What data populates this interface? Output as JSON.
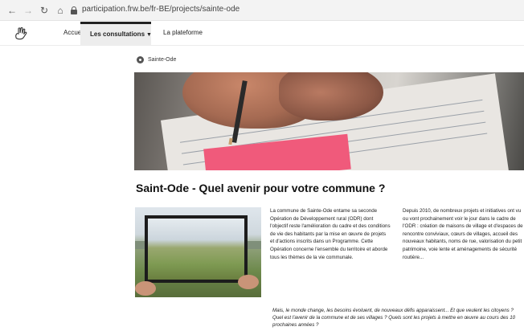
{
  "browser": {
    "back_icon": "arrow-left-icon",
    "forward_icon": "arrow-right-icon",
    "reload_icon": "reload-icon",
    "home_icon": "home-icon",
    "url": "participation.frw.be/fr-BE/projects/sainte-ode"
  },
  "header": {
    "logo_icon": "hand-logo-icon",
    "nav": {
      "accueil": "Accueil",
      "consultations": "Les consultations",
      "plateforme": "La plateforme"
    }
  },
  "breadcrumb": {
    "label": "Sainte-Ode"
  },
  "main": {
    "title": "Saint-Ode - Quel avenir pour votre commune ?",
    "paragraph_left": "La commune de Sainte-Ode entame sa seconde Opération de Développement rural (ODR) dont l'objectif reste l'amélioration du cadre et des conditions de vie des habitants par la mise en œuvre de projets et d'actions inscrits dans un Programme. Cette Opération concerne l'ensemble du territoire et aborde tous les thèmes de la vie communale.",
    "paragraph_right": "Depuis 2010, de nombreux projets et initiatives ont vu ou vont prochainement voir le jour dans le cadre de l'ODR : création de maisons de village et d'espaces de rencontre conviviaux, cœurs de villages, accueil des nouveaux habitants, noms de rue, valorisation du petit patrimoine, voie lente et aménagements de sécurité routière...",
    "quote": "Mais, le monde change, les besoins évoluent, de nouveaux défis apparaissent... Et que veulent les citoyens ? Quel est l'avenir de la commune et de ses villages ? Quels sont les projets à mettre en œuvre au cours des 10 prochaines années ?"
  },
  "colors": {
    "accent_sticky": "#f05a7b",
    "nav_active_bg": "#ededed",
    "text": "#222222"
  }
}
